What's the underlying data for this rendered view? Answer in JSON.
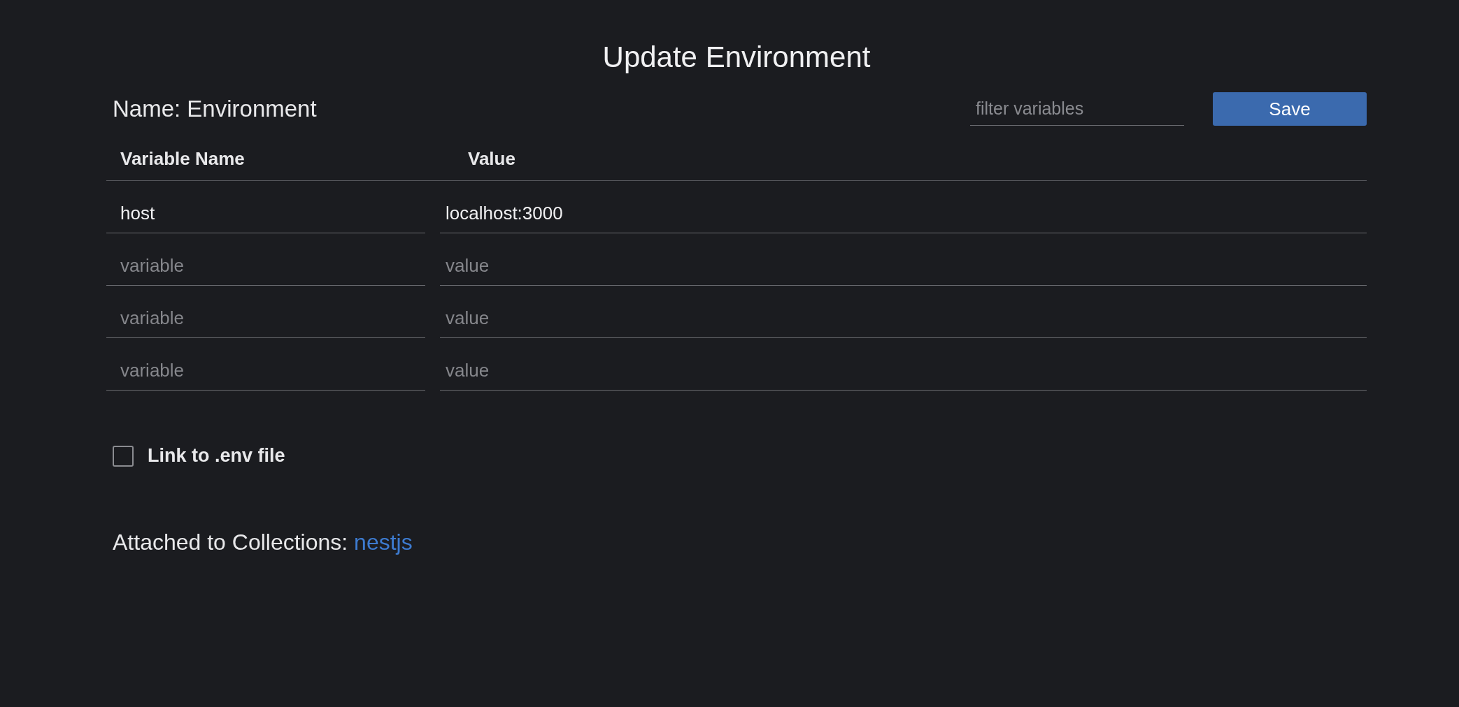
{
  "title": "Update Environment",
  "name_label": "Name: Environment",
  "filter": {
    "placeholder": "filter variables"
  },
  "save_button": "Save",
  "columns": [
    "Variable Name",
    "Value"
  ],
  "rows": [
    {
      "name": "host",
      "value": "localhost:3000"
    },
    {
      "name_placeholder": "variable",
      "value_placeholder": "value"
    },
    {
      "name_placeholder": "variable",
      "value_placeholder": "value"
    },
    {
      "name_placeholder": "variable",
      "value_placeholder": "value"
    }
  ],
  "link_env": {
    "label": "Link to .env file",
    "checked": false
  },
  "attached": {
    "label": "Attached to Collections: ",
    "collections": [
      "nestjs"
    ]
  }
}
